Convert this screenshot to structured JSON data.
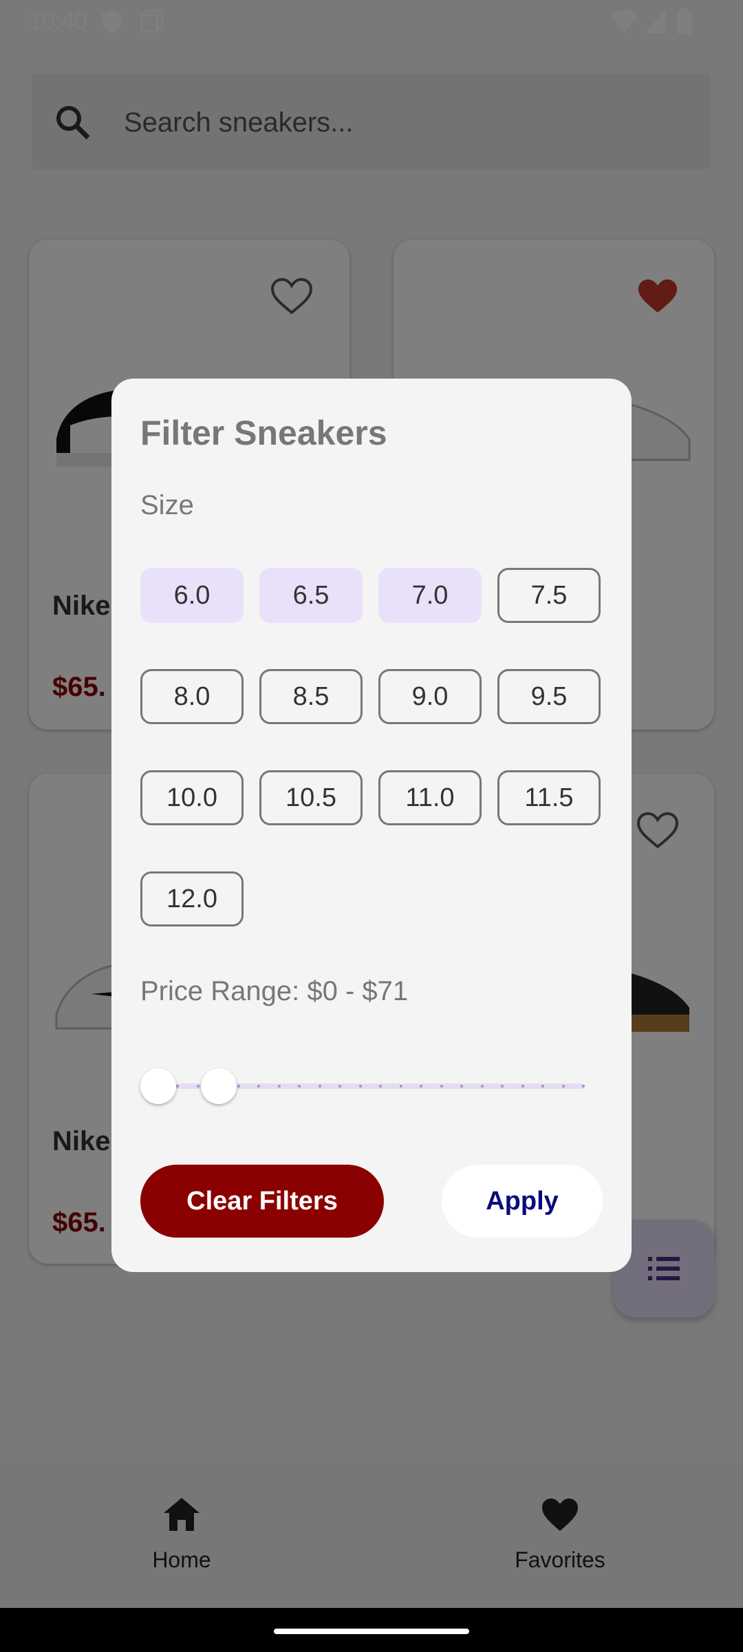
{
  "status": {
    "time": "10:40"
  },
  "search": {
    "placeholder": "Search sneakers..."
  },
  "cards": [
    {
      "name": "Nike",
      "price": "$65.",
      "favorite": false
    },
    {
      "name": "",
      "price": "",
      "favorite": true
    },
    {
      "name": "Nike",
      "price": "$65.",
      "favorite": false
    },
    {
      "name": "",
      "price": "",
      "favorite": false
    }
  ],
  "bottom_nav": {
    "home": "Home",
    "favorites": "Favorites"
  },
  "dialog": {
    "title": "Filter Sneakers",
    "size_label": "Size",
    "sizes": [
      {
        "label": "6.0",
        "selected": true
      },
      {
        "label": "6.5",
        "selected": true
      },
      {
        "label": "7.0",
        "selected": true
      },
      {
        "label": "7.5",
        "selected": false
      },
      {
        "label": "8.0",
        "selected": false
      },
      {
        "label": "8.5",
        "selected": false
      },
      {
        "label": "9.0",
        "selected": false
      },
      {
        "label": "9.5",
        "selected": false
      },
      {
        "label": "10.0",
        "selected": false
      },
      {
        "label": "10.5",
        "selected": false
      },
      {
        "label": "11.0",
        "selected": false
      },
      {
        "label": "11.5",
        "selected": false
      },
      {
        "label": "12.0",
        "selected": false
      }
    ],
    "price_label": "Price Range: $0 - $71",
    "price_min": 0,
    "price_max": 71,
    "clear_label": "Clear Filters",
    "apply_label": "Apply"
  },
  "colors": {
    "accent": "#8b0000",
    "chip_selected": "#e9e1f9",
    "apply_text": "#0b0b7a",
    "heart": "#c0392b"
  }
}
